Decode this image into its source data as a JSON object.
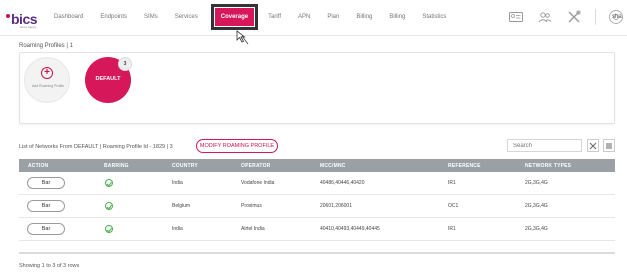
{
  "brand": {
    "logo_text": "bics",
    "tagline": "we're happy"
  },
  "nav": {
    "items": [
      "Dashboard",
      "Endpoints",
      "SIMs",
      "Services",
      "Coverage",
      "Tariff",
      "APN",
      "Plan",
      "Billing",
      "Billing",
      "Statistics"
    ],
    "active": "Coverage"
  },
  "user": {
    "label": "sha"
  },
  "profiles": {
    "title": "Roaming Profiles | 1",
    "add_label": "Add Roaming Profile",
    "default_label": "DEFAULT",
    "default_count": "3"
  },
  "networks": {
    "title": "List of Networks From DEFAULT | Roaming Profile Id - 1829 | 3",
    "modify_button": "MODIFY ROAMING PROFILE",
    "search_placeholder": "Search",
    "columns": [
      "ACTION",
      "BARRING",
      "COUNTRY",
      "OPERATOR",
      "MCC/MNC",
      "REFERENCE",
      "NETWORK TYPES"
    ],
    "rows": [
      {
        "action": "Bar",
        "country": "India",
        "operator": "Vodafone India",
        "mccmnc": "40486,40446,40420",
        "reference": "IR1",
        "types": "2G,3G,4G"
      },
      {
        "action": "Bar",
        "country": "Belgium",
        "operator": "Proximus",
        "mccmnc": "20601,206001",
        "reference": "OC1",
        "types": "2G,3G,4G"
      },
      {
        "action": "Bar",
        "country": "India",
        "operator": "Airtel India",
        "mccmnc": "40410,40493,40449,40445",
        "reference": "IR1",
        "types": "2G,3G,4G"
      }
    ],
    "footer": "Showing 1 to 3 of 3 rows"
  },
  "colors": {
    "accent": "#d6175a",
    "header_gray": "#9aa0a4",
    "ok_green": "#4caf50"
  }
}
